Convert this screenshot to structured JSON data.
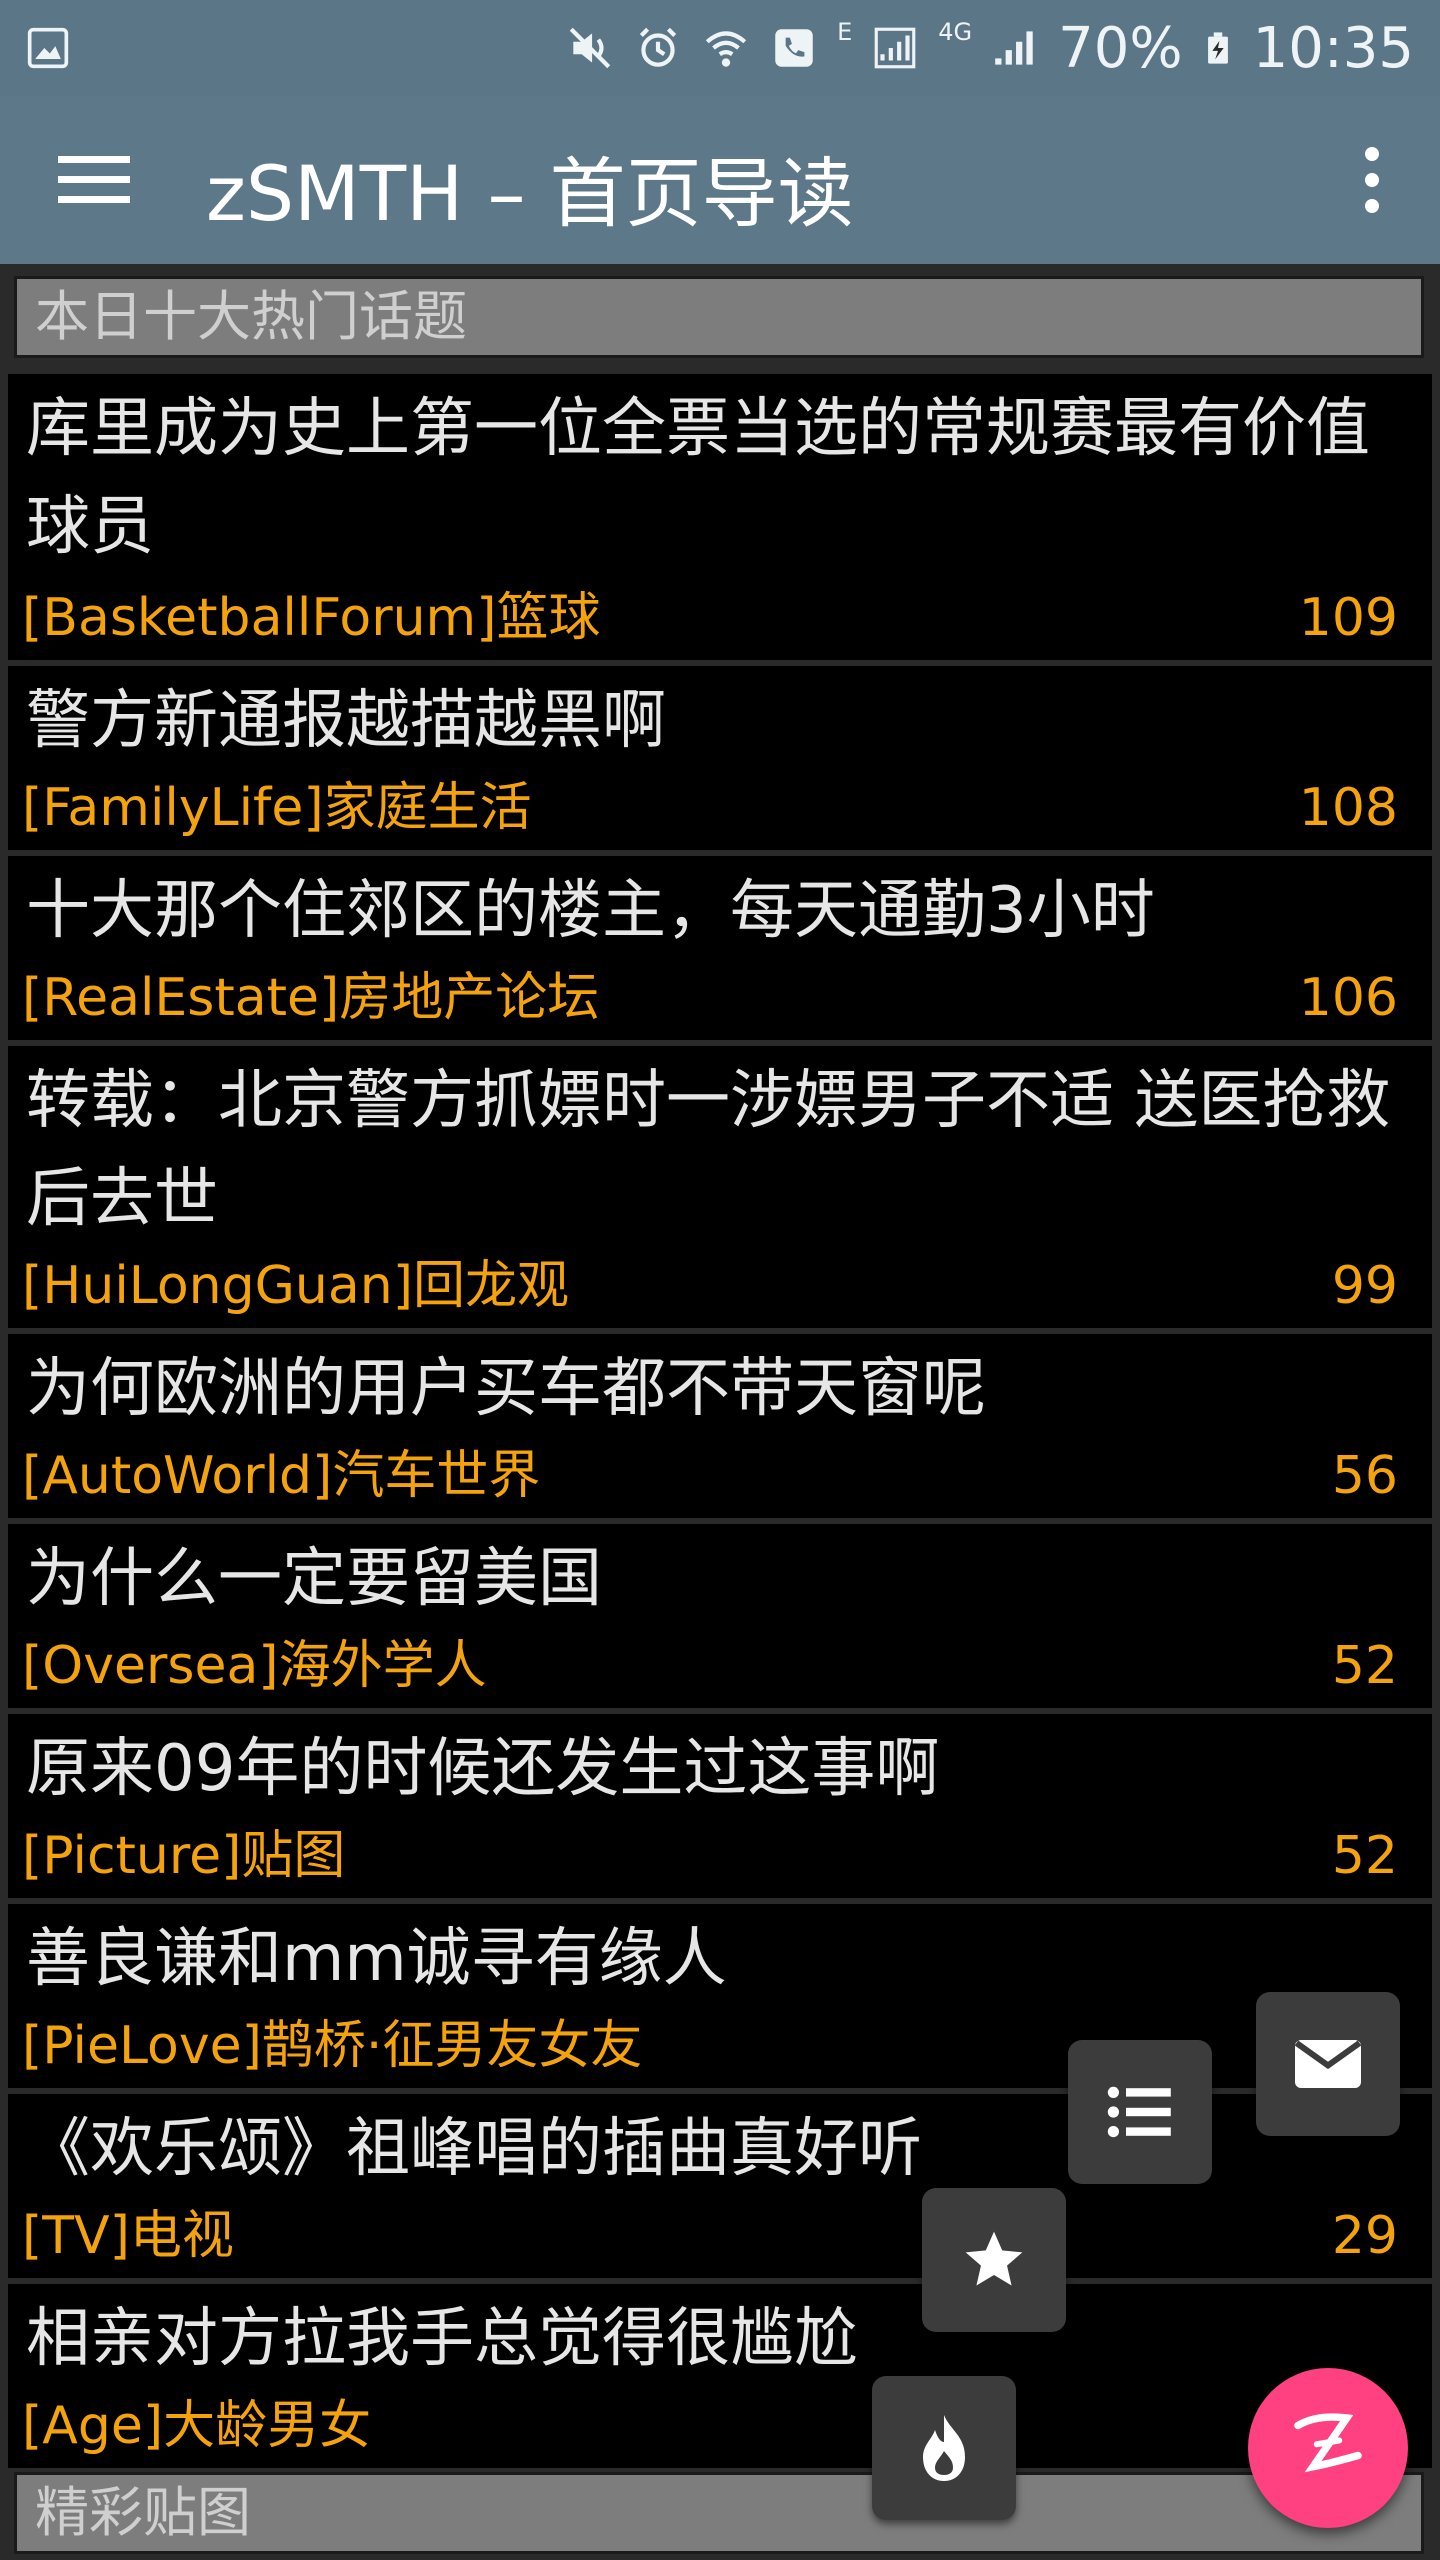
{
  "status_bar": {
    "network_type": "E",
    "network_4g": "4G",
    "battery": "70%",
    "time": "10:35",
    "icons": [
      "picture-icon",
      "mute-icon",
      "alarm-icon",
      "wifi-call-icon",
      "phone-icon",
      "signal-icon",
      "signal-4g-icon",
      "battery-charging-icon"
    ]
  },
  "app_bar": {
    "title": "zSMTH – 首页导读",
    "menu_icon": "hamburger-icon",
    "more_icon": "more-vert-icon"
  },
  "sections": [
    {
      "title": "本日十大热门话题"
    },
    {
      "title": "精彩贴图"
    }
  ],
  "topics": [
    {
      "title": "库里成为史上第一位全票当选的常规赛最有价值球员",
      "board": "[BasketballForum]篮球",
      "count": "109"
    },
    {
      "title": "警方新通报越描越黑啊",
      "board": "[FamilyLife]家庭生活",
      "count": "108"
    },
    {
      "title": "十大那个住郊区的楼主，每天通勤3小时",
      "board": "[RealEstate]房地产论坛",
      "count": "106"
    },
    {
      "title": "转载：北京警方抓嫖时一涉嫖男子不适 送医抢救后去世",
      "board": "[HuiLongGuan]回龙观",
      "count": "99"
    },
    {
      "title": "为何欧洲的用户买车都不带天窗呢",
      "board": "[AutoWorld]汽车世界",
      "count": "56"
    },
    {
      "title": "为什么一定要留美国",
      "board": "[Oversea]海外学人",
      "count": "52"
    },
    {
      "title": "原来09年的时候还发生过这事啊",
      "board": "[Picture]贴图",
      "count": "52"
    },
    {
      "title": "善良谦和mm诚寻有缘人",
      "board": "[PieLove]鹊桥·征男友女友",
      "count": ""
    },
    {
      "title": "《欢乐颂》祖峰唱的插曲真好听",
      "board": "[TV]电视",
      "count": "29"
    },
    {
      "title": "相亲对方拉我手总觉得很尴尬",
      "board": "[Age]大龄男女",
      "count": ""
    }
  ],
  "fab": {
    "mail_icon": "mail-icon",
    "list_icon": "list-icon",
    "star_icon": "star-icon",
    "hot_icon": "flame-icon",
    "main_icon": "zsmth-logo-icon",
    "main_color": "#ff4081"
  }
}
